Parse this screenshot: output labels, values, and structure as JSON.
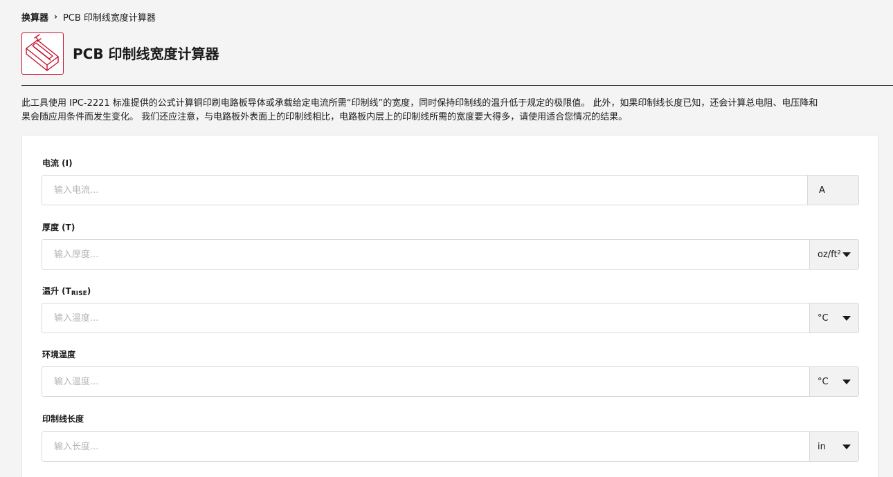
{
  "breadcrumb": {
    "root": "换算器",
    "separator": "›",
    "current": "PCB 印制线宽度计算器"
  },
  "header": {
    "title": "PCB 印制线宽度计算器",
    "logo_icon": "pcb-trace-icon",
    "accent_color": "#c8102e"
  },
  "description": {
    "line1": "此工具使用 IPC-2221 标准提供的公式计算铜印刷电路板导体或承载给定电流所需“印制线”的宽度，同时保持印制线的温升低于规定的极限值。 此外，如果印制线长度已知，还会计算总电阻、电压降和",
    "line2": "果会随应用条件而发生变化。 我们还应注意，与电路板外表面上的印制线相比，电路板内层上的印制线所需的宽度要大得多，请使用适合您情况的结果。"
  },
  "form": {
    "current": {
      "label": "电流 (I)",
      "placeholder": "输入电流...",
      "unit": "A"
    },
    "thickness": {
      "label": "厚度 (T)",
      "placeholder": "输入厚度...",
      "unit": "oz/ft²"
    },
    "temp_rise": {
      "label_main": "温升 (T",
      "label_sub": "RISE",
      "label_end": ")",
      "placeholder": "输入温度...",
      "unit": "°C"
    },
    "ambient_temp": {
      "label": "环境温度",
      "placeholder": "输入温度...",
      "unit": "°C"
    },
    "trace_length": {
      "label": "印制线长度",
      "placeholder": "输入长度...",
      "unit": "in"
    }
  }
}
